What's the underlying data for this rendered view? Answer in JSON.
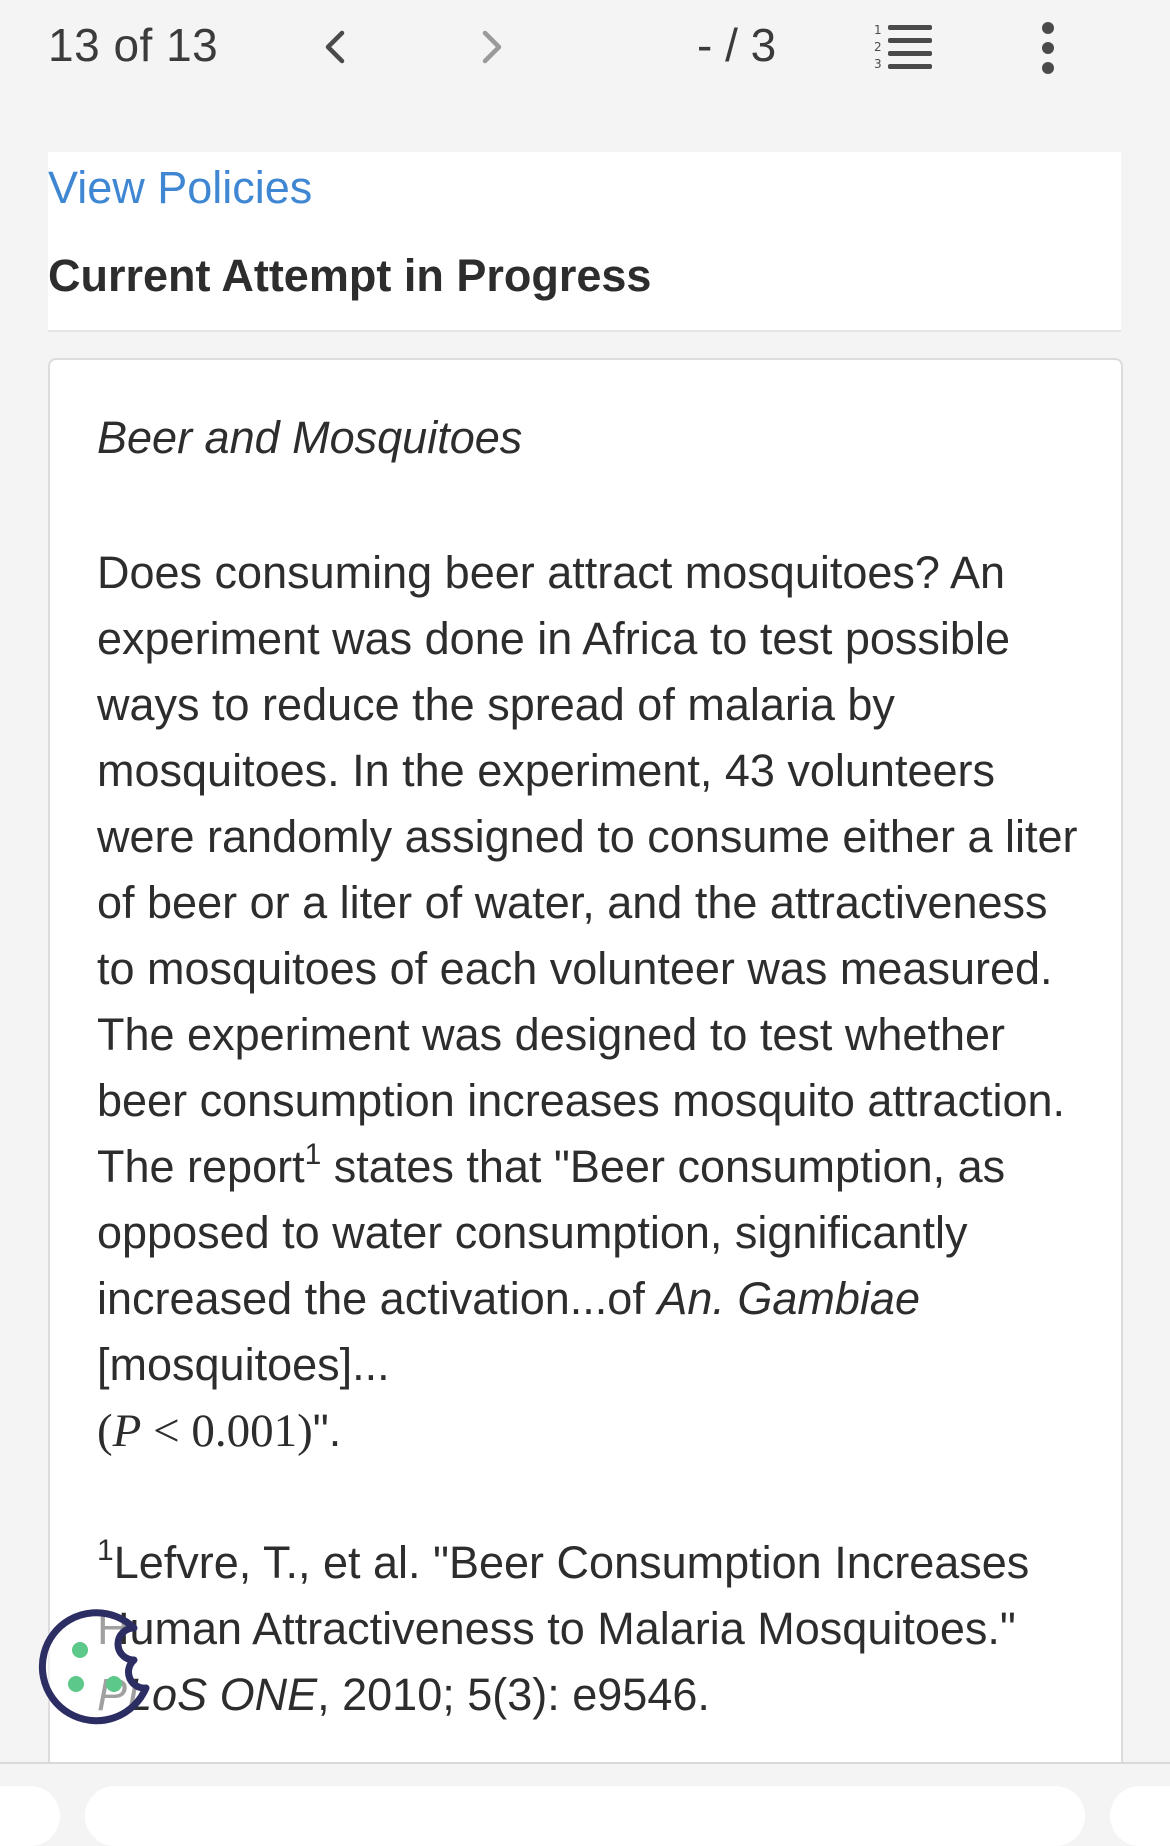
{
  "toolbar": {
    "question_counter": "13 of 13",
    "score": "- / 3",
    "prev_icon": "chevron-left-icon",
    "next_icon": "chevron-right-icon",
    "list_icon": "numbered-list-icon",
    "more_icon": "more-vertical-icon"
  },
  "header": {
    "view_policies": "View Policies",
    "attempt_status": "Current Attempt in Progress"
  },
  "question": {
    "title": "Beer and Mosquitoes",
    "body_part1": "Does consuming beer attract mosquitoes? An experiment was done in Africa to test possible ways to reduce the spread of malaria by mosquitoes. In the experiment, 43 volunteers were randomly assigned to consume either a liter of beer or a liter of water, and the attractiveness to mosquitoes of each volunteer was measured. The experiment was designed to test whether beer consumption increases mosquito attraction. The report",
    "body_sup": "1",
    "body_part2": " states that \"Beer consumption, as opposed to water consumption, significantly increased the activation...of ",
    "species": "An. Gambiae",
    "body_part3": " [mosquitoes]...",
    "math_open": "(",
    "math_var": "P",
    "math_rest": " < 0.001)",
    "body_end": "\".",
    "footnote_sup": "1",
    "footnote_text": "Lefvre, T., et al. \"Beer Consumption Increases Human Attractiveness to Malaria Mosquitoes.\" ",
    "footnote_journal": "PLoS ONE",
    "footnote_end": ", 2010; 5(3): e9546."
  },
  "cookie": {
    "icon": "cookie-icon"
  },
  "colors": {
    "link": "#3f87d2",
    "cookie_outline": "#2b2d63",
    "cookie_dots": "#5cc98a"
  }
}
